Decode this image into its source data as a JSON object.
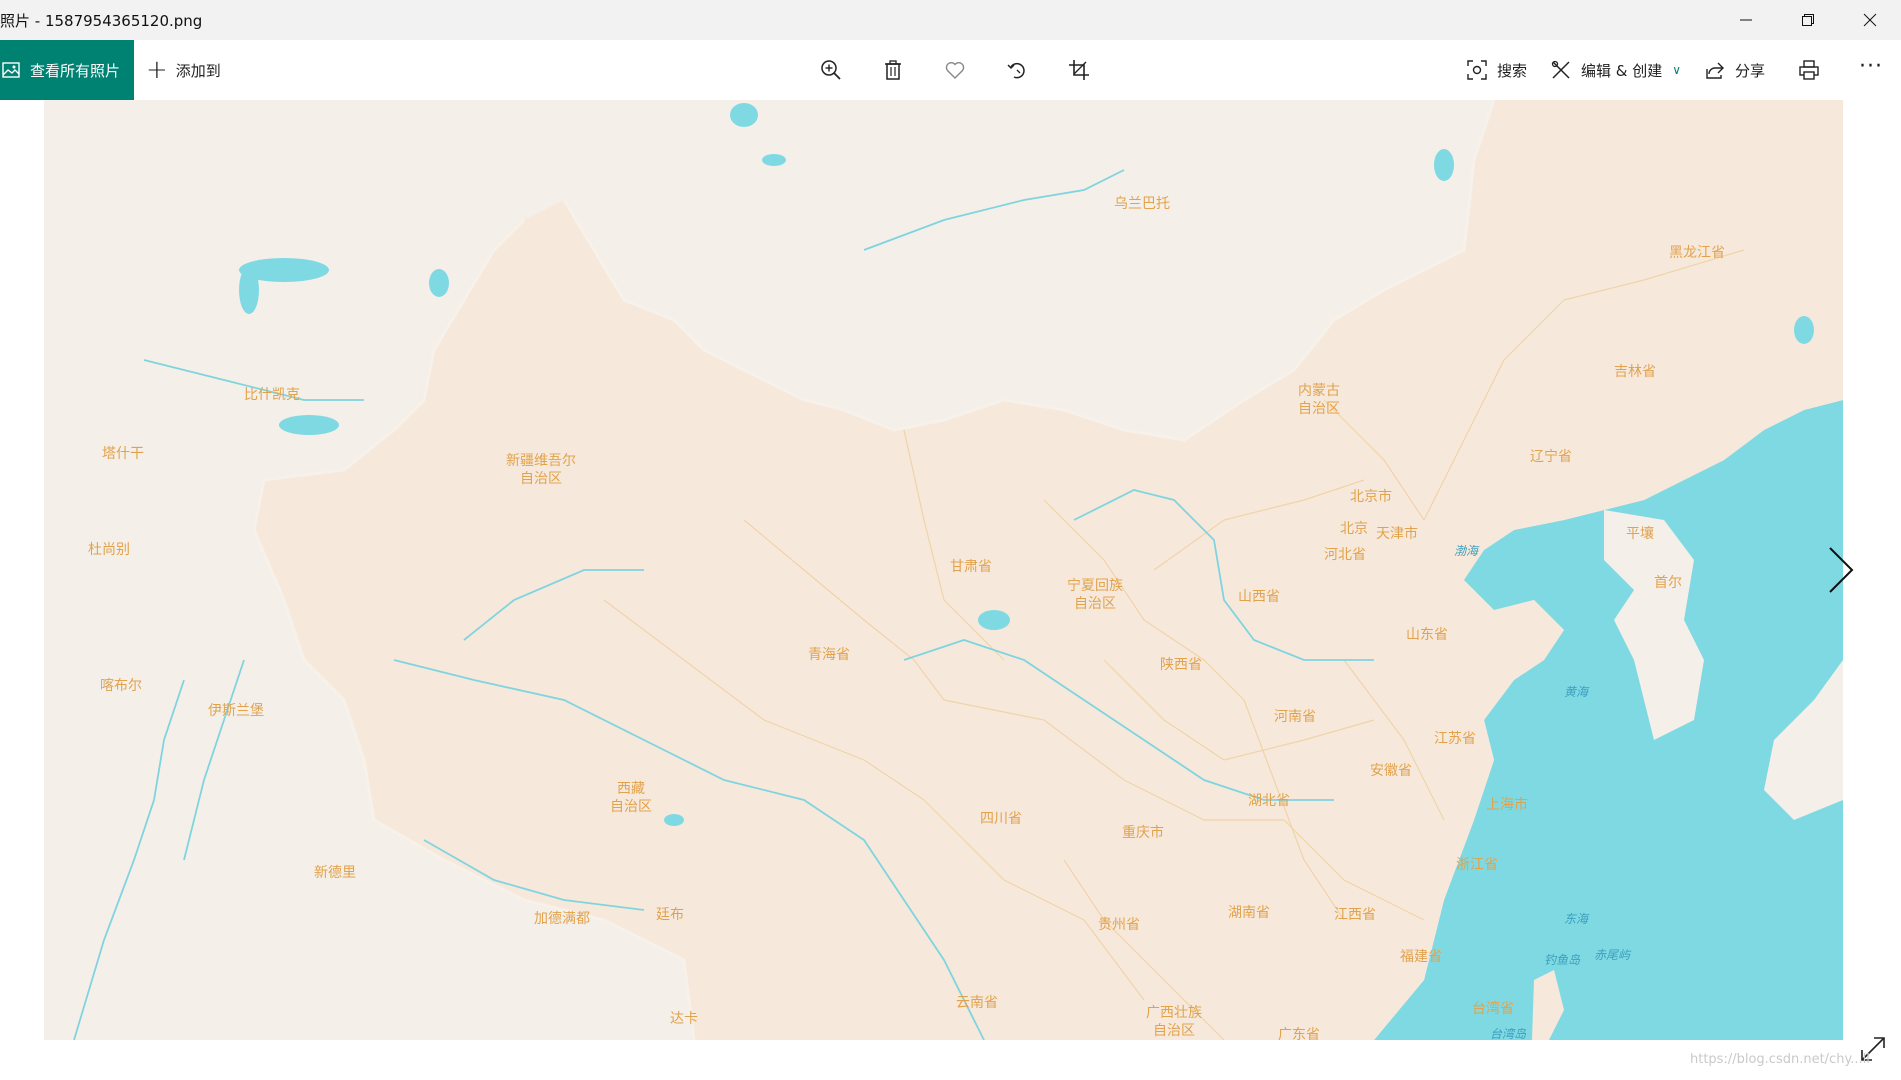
{
  "window": {
    "title": "照片 - 1587954365120.png"
  },
  "toolbar": {
    "view_all_label": "查看所有照片",
    "add_to_label": "添加到",
    "search_label": "搜索",
    "edit_create_label": "编辑 & 创建",
    "share_label": "分享",
    "more_label": "···"
  },
  "map": {
    "labels": [
      {
        "text": "乌兰巴托"
      },
      {
        "text": "黑龙江省"
      },
      {
        "text": "吉林省"
      },
      {
        "text": "内蒙古\n自治区"
      },
      {
        "text": "辽宁省"
      },
      {
        "text": "比什凯克"
      },
      {
        "text": "塔什干"
      },
      {
        "text": "新疆维吾尔\n自治区"
      },
      {
        "text": "北京市"
      },
      {
        "text": "北京"
      },
      {
        "text": "天津市"
      },
      {
        "text": "平壤"
      },
      {
        "text": "杜尚别"
      },
      {
        "text": "甘肃省"
      },
      {
        "text": "河北省"
      },
      {
        "text": "首尔"
      },
      {
        "text": "宁夏回族\n自治区"
      },
      {
        "text": "山西省"
      },
      {
        "text": "山东省"
      },
      {
        "text": "青海省"
      },
      {
        "text": "陕西省"
      },
      {
        "text": "喀布尔"
      },
      {
        "text": "伊斯兰堡"
      },
      {
        "text": "河南省"
      },
      {
        "text": "江苏省"
      },
      {
        "text": "安徽省"
      },
      {
        "text": "西藏\n自治区"
      },
      {
        "text": "四川省"
      },
      {
        "text": "湖北省"
      },
      {
        "text": "上海市"
      },
      {
        "text": "重庆市"
      },
      {
        "text": "新德里"
      },
      {
        "text": "浙江省"
      },
      {
        "text": "湖南省"
      },
      {
        "text": "江西省"
      },
      {
        "text": "加德满都"
      },
      {
        "text": "廷布"
      },
      {
        "text": "贵州省"
      },
      {
        "text": "福建省"
      },
      {
        "text": "钓鱼岛"
      },
      {
        "text": "赤尾屿"
      },
      {
        "text": "云南省"
      },
      {
        "text": "广西壮族\n自治区"
      },
      {
        "text": "台湾省"
      },
      {
        "text": "达卡"
      },
      {
        "text": "广东省"
      },
      {
        "text": "台湾岛"
      }
    ],
    "sea_labels": [
      {
        "text": "渤海"
      },
      {
        "text": "黄海"
      },
      {
        "text": "东海"
      }
    ]
  },
  "watermark": "https://blog.csdn.net/chy...ll",
  "colors": {
    "accent": "#008272",
    "land": "#f6e9dc",
    "foreign_land": "#f4efe8",
    "sea": "#7fd9e3",
    "label": "#e2a24c",
    "river": "#7fd4e0"
  }
}
